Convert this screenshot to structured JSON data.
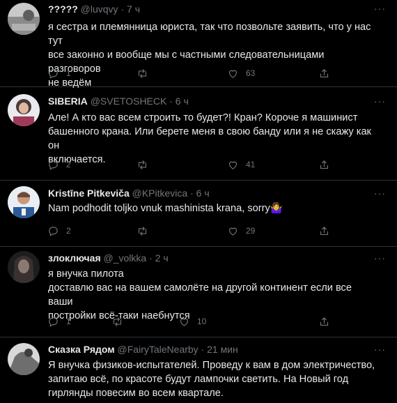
{
  "tweets": [
    {
      "name": "?????",
      "handle": "@luvqvy",
      "dot": "·",
      "time": "7 ч",
      "lines": [
        "я сестра и племянница юриста, так что позвольте заявить, что у нас тут",
        "все законно и вообще мы с частными следовательницами разговоров",
        "не ведём"
      ],
      "replies": "1",
      "retweets": "",
      "likes": "63"
    },
    {
      "name": "SIBERIA",
      "handle": "@SVETOSHECK",
      "dot": "·",
      "time": "6 ч",
      "lines": [
        "Але! А кто вас всем строить то будет?! Кран? Короче я машинист",
        "башенного крана. Или берете меня в свою банду или я не скажу как он",
        "включается."
      ],
      "replies": "2",
      "retweets": "",
      "likes": "41"
    },
    {
      "name": "Kristīne Pitkeviča",
      "handle": "@KPitkevica",
      "dot": "·",
      "time": "6 ч",
      "lines": [
        "Nam podhodit toljko vnuk mashinista krana, sorry🤷‍♀️"
      ],
      "replies": "2",
      "retweets": "",
      "likes": "29"
    },
    {
      "name": "злоключая",
      "handle": "@_volkka",
      "dot": "·",
      "time": "2 ч",
      "lines": [
        "я внучка пилота",
        "доставлю вас на вашем самолёте на другой континент если все ваши",
        "постройки всё-таки наебнутся"
      ],
      "replies": "1",
      "retweets": "",
      "likes": "10"
    },
    {
      "name": "Сказка Рядом",
      "handle": "@FairyTaleNearby",
      "dot": "·",
      "time": "21 мин",
      "lines": [
        "Я внучка физиков-испытателей. Проведу к вам в дом электричество,",
        "запитаю всё, по красоте будут лампочки светить. На Новый год",
        "гирлянды повесим во всем квартале."
      ],
      "replies": "",
      "retweets": "",
      "likes": ""
    }
  ],
  "more_glyph": "···",
  "icons": {
    "reply": "reply-icon",
    "retweet": "retweet-icon",
    "like": "heart-icon",
    "share": "share-icon"
  },
  "colors": {
    "background": "#000000",
    "text": "#e7e9ea",
    "muted": "#71767b",
    "divider": "#2f3336"
  }
}
